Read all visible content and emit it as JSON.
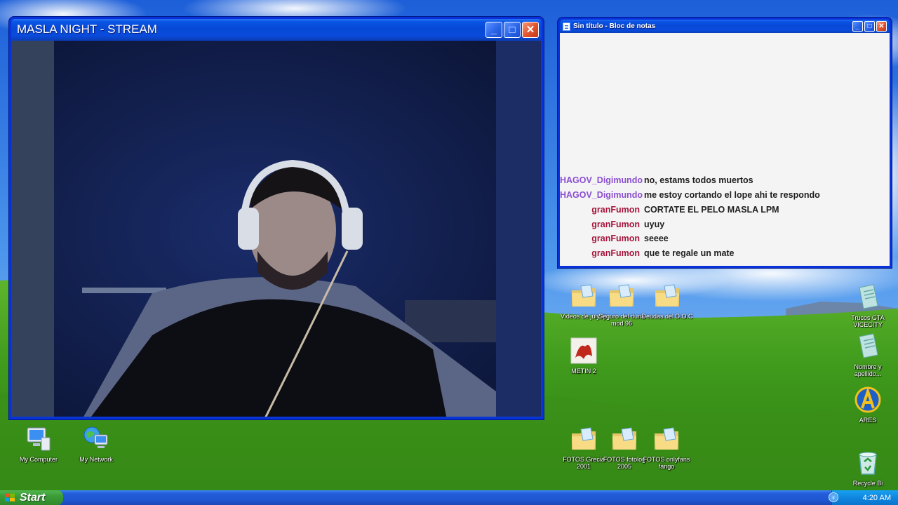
{
  "stream_window": {
    "title": "MASLA NIGHT - STREAM",
    "minimize": "_",
    "maximize": "□",
    "close": "✕"
  },
  "notepad_window": {
    "title": "Sin título - Bloc de notas",
    "minimize": "_",
    "maximize": "□",
    "close": "✕",
    "chat": [
      {
        "user": "HAGOV_Digimundo",
        "color": "#8a4fcf",
        "message": "no, estams todos muertos"
      },
      {
        "user": "HAGOV_Digimundo",
        "color": "#8a4fcf",
        "message": "me estoy cortando el lope ahi te respondo"
      },
      {
        "user": "granFumon",
        "color": "#a4163c",
        "message": "CORTATE EL PELO MASLA LPM"
      },
      {
        "user": "granFumon",
        "color": "#a4163c",
        "message": "uyuy"
      },
      {
        "user": "granFumon",
        "color": "#a4163c",
        "message": "seeee"
      },
      {
        "user": "granFumon",
        "color": "#a4163c",
        "message": "que te regale un mate"
      }
    ]
  },
  "desktop": {
    "icons": {
      "my_computer": "My Computer",
      "my_network": "My Network",
      "videos_july": "Videos de july3p",
      "seguro": "Seguro del duna mod 96",
      "deudas": "Deudas del D.O.C",
      "metin": "METIN 2",
      "fotos_grecia": "FOTOS Grecia 2001",
      "fotos_fotolog": "FOTOS fotolog 2005",
      "fotos_onlyfans": "FOTOS onlyfans fango",
      "trucos": "Trucos GTA VICECITY",
      "nombre": "Nombre y apellido...",
      "ares": "ARES",
      "recycle": "Recycle Bi"
    }
  },
  "taskbar": {
    "start_label": "Start",
    "clock": "4:20 AM",
    "tray_arrow": "‹"
  },
  "colors": {
    "xp_blue": "#0a4bdc",
    "start_green": "#3c9c37",
    "username_purple": "#8a4fcf",
    "username_red": "#a4163c"
  }
}
